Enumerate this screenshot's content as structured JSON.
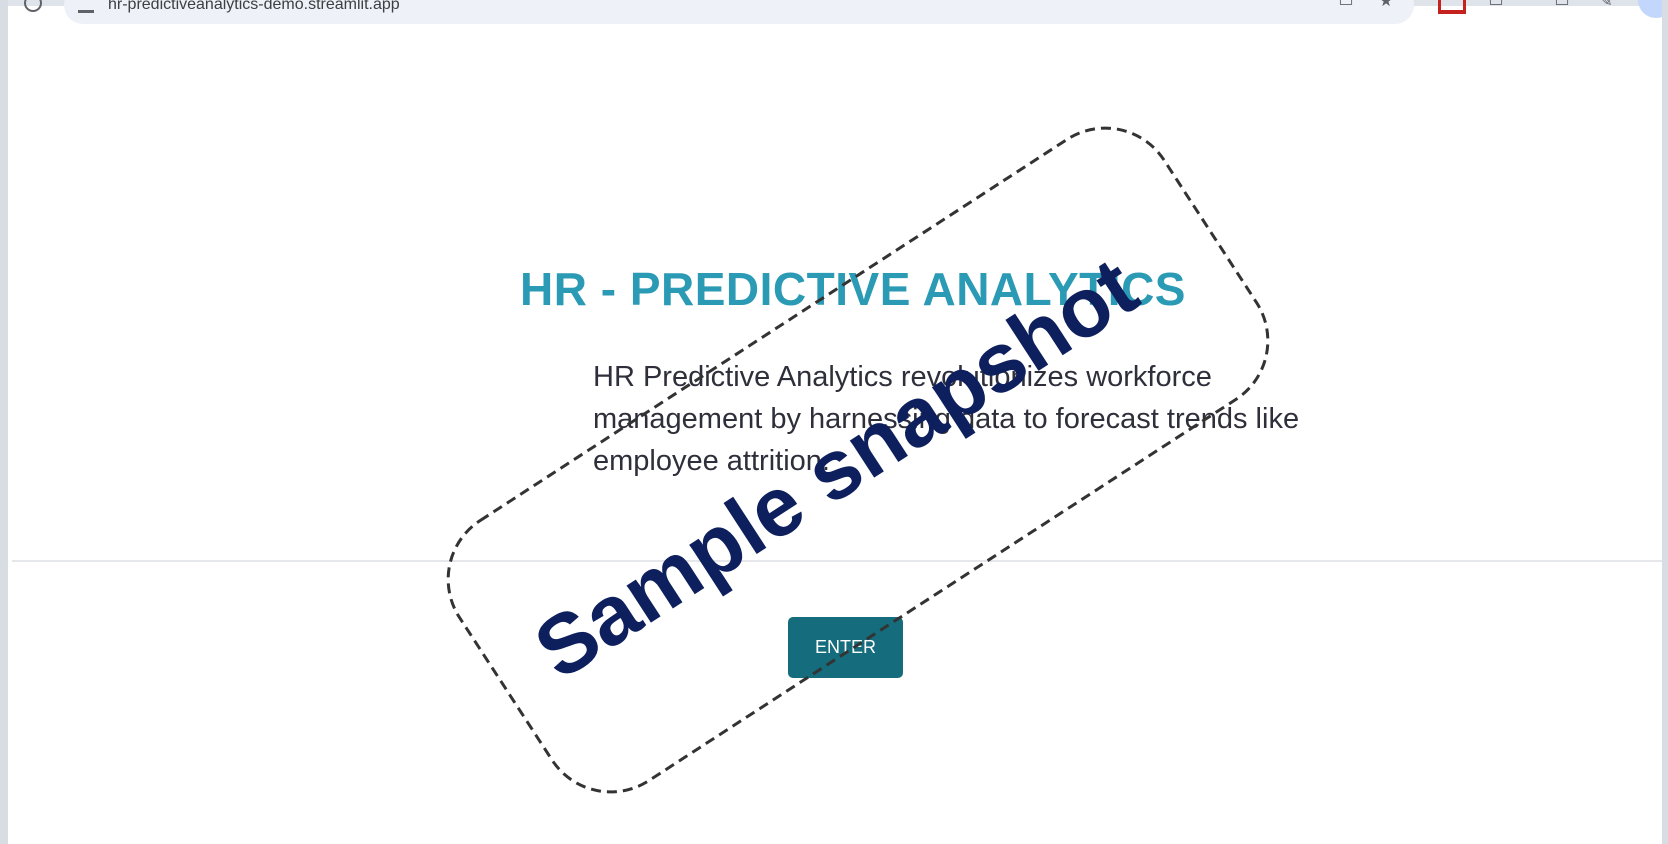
{
  "browser": {
    "url": "hr-predictiveanalytics-demo.streamlit.app"
  },
  "app": {
    "title": "HR - PREDICTIVE ANALYTICS",
    "description": "HR Predictive Analytics revolutionizes workforce management by harnessing data to forecast trends like employee attrition.",
    "enter_label": "ENTER"
  },
  "watermark": {
    "text": "Sample snapshot"
  },
  "colors": {
    "title": "#2a9ab5",
    "button": "#146c7c",
    "watermark": "#0d1f5c"
  },
  "icons": [
    "reload-icon",
    "site-info-icon",
    "cast-icon",
    "bookmark-star-icon",
    "extension-icon",
    "tab-icon",
    "download-icon",
    "puzzle-icon",
    "profile-avatar-icon"
  ]
}
